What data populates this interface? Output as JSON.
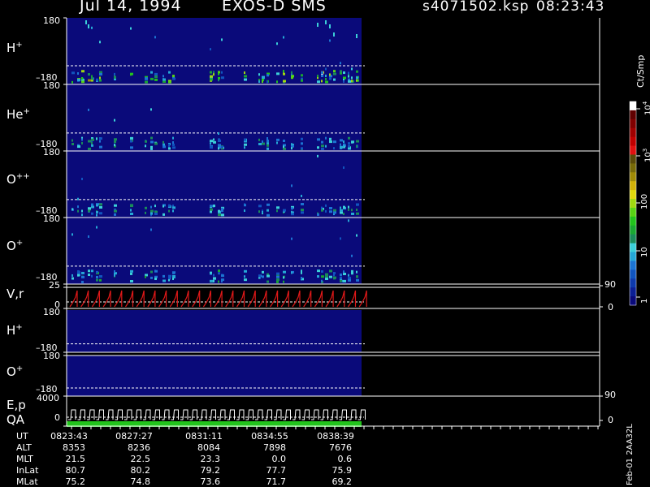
{
  "header": {
    "date": "Jul 14, 1994",
    "mission": "EXOS-D SMS",
    "file": "s4071502.ksp",
    "time": "08:23:43"
  },
  "panels": [
    {
      "label": "H",
      "sup": "+",
      "ytop": "180",
      "ybot": "–180",
      "dense": 1.0,
      "threshold": 0.28
    },
    {
      "label": "He",
      "sup": "+",
      "ytop": "180",
      "ybot": "–180",
      "dense": 0.55,
      "threshold": 0.27
    },
    {
      "label": "O",
      "sup": "++",
      "ytop": "180",
      "ybot": "–180",
      "dense": 0.55,
      "threshold": 0.27
    },
    {
      "label": "O",
      "sup": "+",
      "ytop": "180",
      "ybot": "–180",
      "dense": 0.6,
      "threshold": 0.27
    },
    {
      "label": "H",
      "sup": "+",
      "ytop": "180",
      "ybot": "–180",
      "dense": 0.0,
      "threshold": 0.2
    },
    {
      "label": "O",
      "sup": "+",
      "ytop": "180",
      "ybot": "–180",
      "dense": 0.0,
      "threshold": 0.2
    }
  ],
  "vr_panel": {
    "label": "V,r",
    "left_top": "25",
    "left_bottom": "0",
    "right_top": "90",
    "right_bottom": "0"
  },
  "ep_panel": {
    "label1": "E,p",
    "label2": "QA",
    "left_top": "4000",
    "left_bottom": "0",
    "right_top": "90",
    "right_bottom": "0"
  },
  "colorbar": {
    "title": "Ct/Smp",
    "ticks": [
      {
        "label": "1",
        "sup": ""
      },
      {
        "label": "10",
        "sup": ""
      },
      {
        "label": "100",
        "sup": ""
      },
      {
        "label": "10",
        "sup": "3"
      },
      {
        "label": "10",
        "sup": "4"
      }
    ],
    "colors": [
      "#0a0a7a",
      "#0b1f95",
      "#0e3aac",
      "#1155bf",
      "#1c74d2",
      "#25a8d6",
      "#3cd0d8",
      "#1a8c5a",
      "#1aa832",
      "#22c41c",
      "#58d414",
      "#a0d810",
      "#e0d80c",
      "#d0b008",
      "#a08a06",
      "#786a08",
      "#5a4a08",
      "#e01010",
      "#c00000",
      "#a00000",
      "#800000",
      "#600000",
      "#ffffff"
    ]
  },
  "footer": {
    "rows": [
      {
        "name": "UT",
        "values": [
          "0823:43",
          "0827:27",
          "0831:11",
          "0834:55",
          "0838:39"
        ]
      },
      {
        "name": "ALT",
        "values": [
          "8353",
          "8236",
          "8084",
          "7898",
          "7676"
        ]
      },
      {
        "name": "MLT",
        "values": [
          "21.5",
          "22.5",
          "23.3",
          "0.0",
          "0.6"
        ]
      },
      {
        "name": "InLat",
        "values": [
          "80.7",
          "80.2",
          "79.2",
          "77.7",
          "75.9"
        ]
      },
      {
        "name": "MLat",
        "values": [
          "75.2",
          "74.8",
          "73.6",
          "71.7",
          "69.2"
        ]
      }
    ],
    "version": "Feb-01 2AA32L"
  },
  "chart_data": {
    "type": "heatmap",
    "title": "Jul 14, 1994   EXOS-D SMS",
    "x": [
      "0823:43",
      "0827:27",
      "0831:11",
      "0834:55",
      "0838:39"
    ],
    "ylim": [
      -180,
      180
    ],
    "colorbar_label": "Ct/Smp",
    "colorbar_range": [
      1,
      10000
    ],
    "colorbar_scale": "log",
    "series": [
      {
        "name": "H+"
      },
      {
        "name": "He+"
      },
      {
        "name": "O++"
      },
      {
        "name": "O+"
      },
      {
        "name": "V,r"
      },
      {
        "name": "H+"
      },
      {
        "name": "O+"
      },
      {
        "name": "E,p"
      },
      {
        "name": "QA"
      }
    ],
    "rows": [
      "UT",
      "ALT",
      "MLT",
      "InLat",
      "MLat"
    ]
  }
}
